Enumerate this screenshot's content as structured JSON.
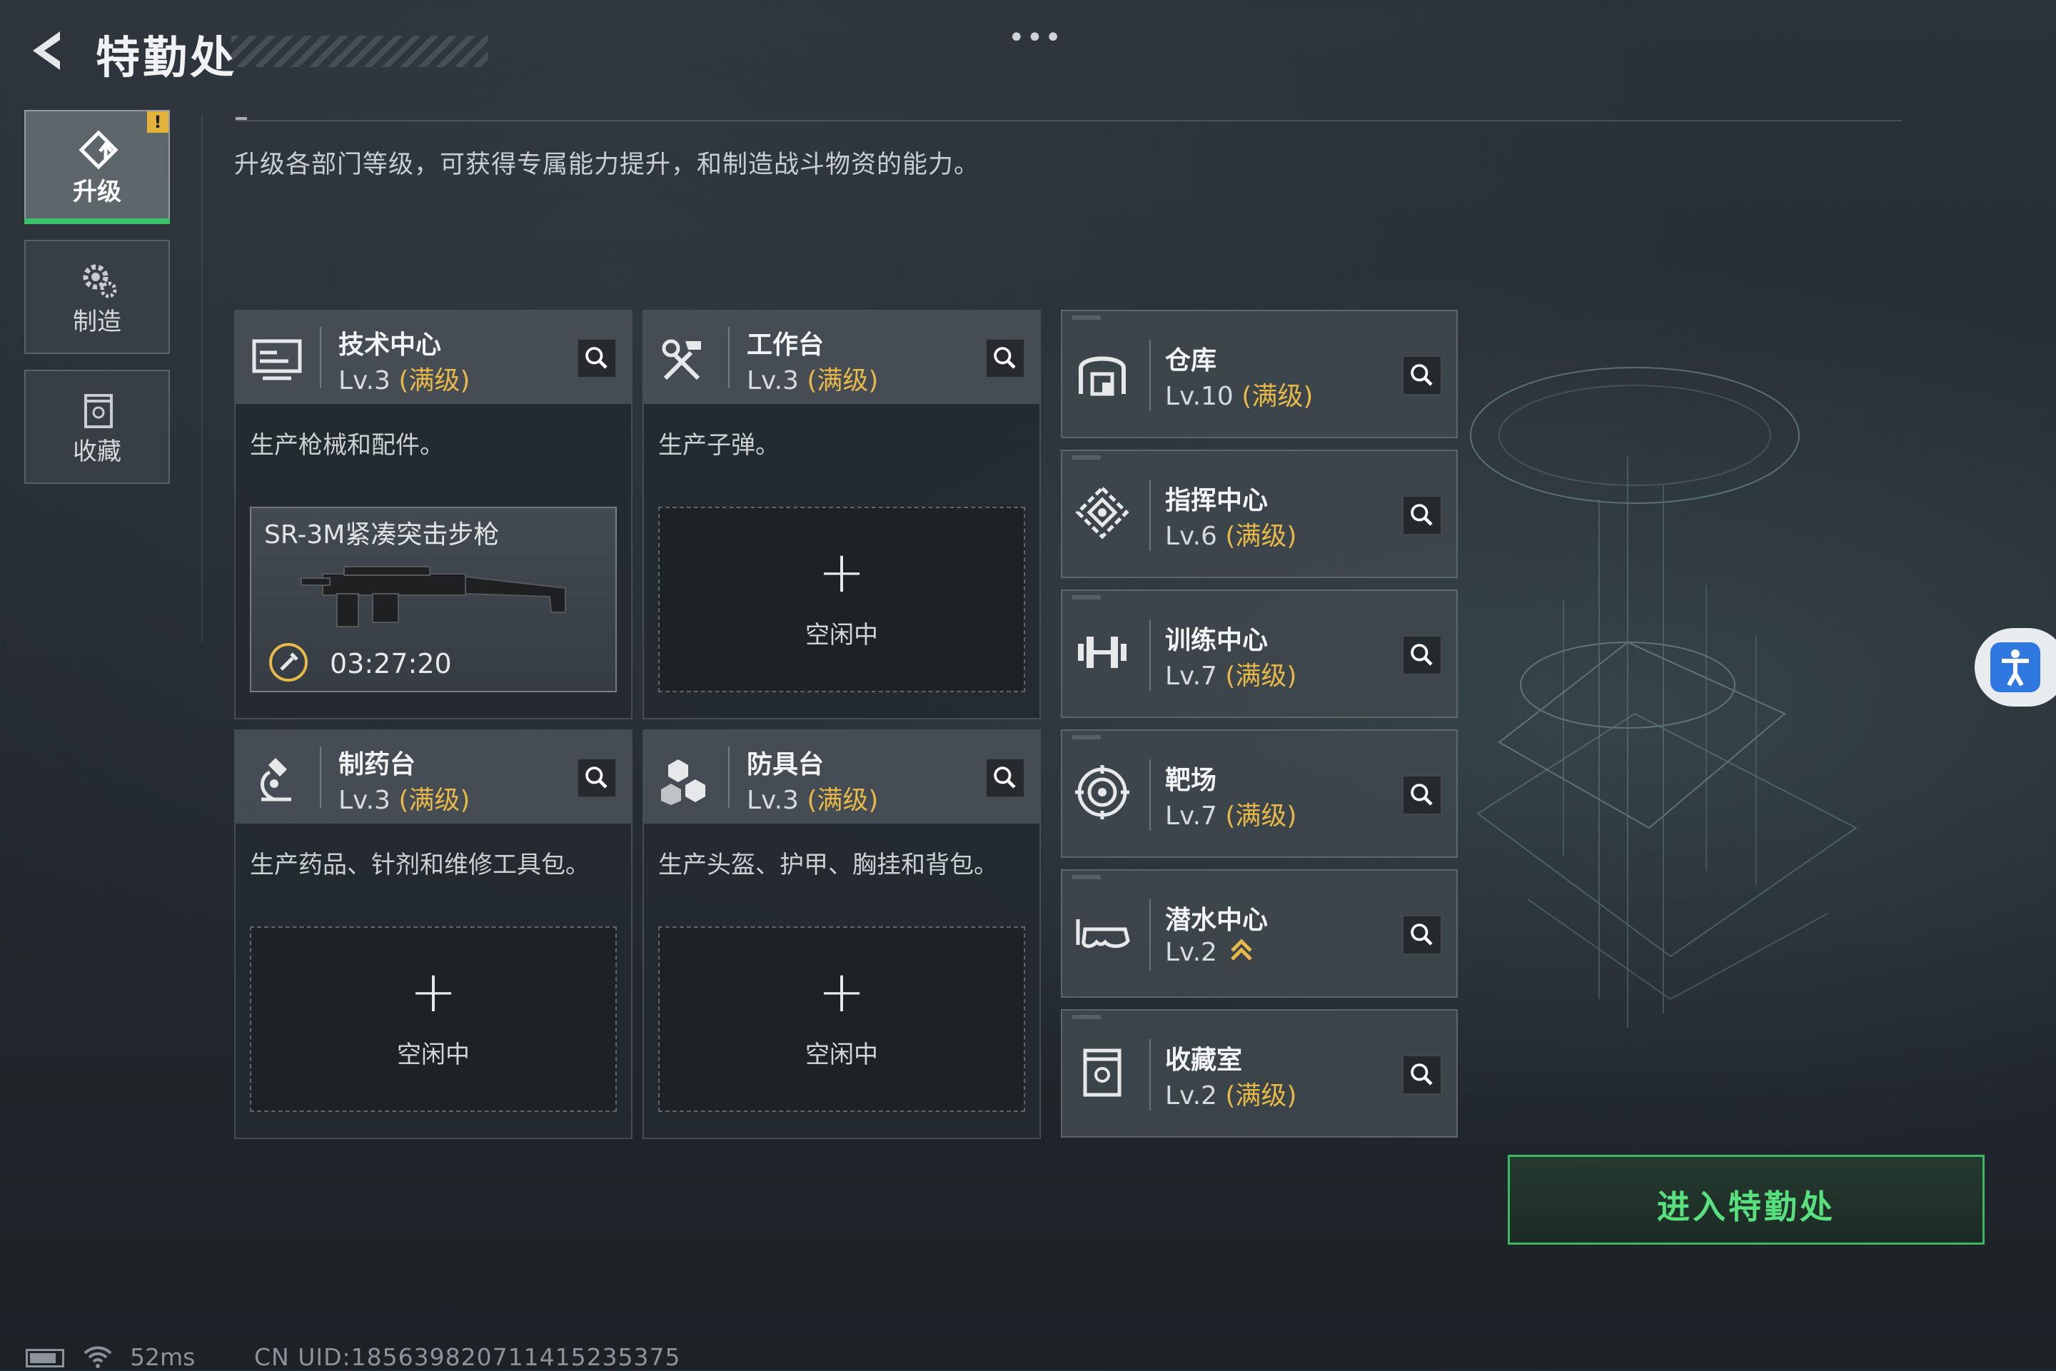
{
  "header": {
    "title": "特勤处",
    "more_label": "•••"
  },
  "sidebar": {
    "items": [
      {
        "label": "升级",
        "icon": "upgrade-icon",
        "active": true,
        "badge": "!"
      },
      {
        "label": "制造",
        "icon": "gear-icon",
        "active": false
      },
      {
        "label": "收藏",
        "icon": "collection-icon",
        "active": false
      }
    ]
  },
  "description": "升级各部门等级，可获得专属能力提升，和制造战斗物资的能力。",
  "workshops": [
    {
      "name": "技术中心",
      "level": "Lv.3",
      "max_label": "(满级)",
      "icon": "monitor-icon",
      "desc": "生产枪械和配件。",
      "slot": {
        "state": "producing",
        "item": "SR-3M紧凑突击步枪",
        "timer": "03:27:20"
      }
    },
    {
      "name": "工作台",
      "level": "Lv.3",
      "max_label": "(满级)",
      "icon": "tools-icon",
      "desc": "生产子弹。",
      "slot": {
        "state": "idle",
        "plus": "+",
        "idle_label": "空闲中"
      }
    },
    {
      "name": "制药台",
      "level": "Lv.3",
      "max_label": "(满级)",
      "icon": "microscope-icon",
      "desc": "生产药品、针剂和维修工具包。",
      "slot": {
        "state": "idle",
        "plus": "+",
        "idle_label": "空闲中"
      }
    },
    {
      "name": "防具台",
      "level": "Lv.3",
      "max_label": "(满级)",
      "icon": "armor-icon",
      "desc": "生产头盔、护甲、胸挂和背包。",
      "slot": {
        "state": "idle",
        "plus": "+",
        "idle_label": "空闲中"
      }
    }
  ],
  "buildings": [
    {
      "name": "仓库",
      "level": "Lv.10",
      "max_label": "(满级)",
      "icon": "warehouse-icon"
    },
    {
      "name": "指挥中心",
      "level": "Lv.6",
      "max_label": "(满级)",
      "icon": "command-icon"
    },
    {
      "name": "训练中心",
      "level": "Lv.7",
      "max_label": "(满级)",
      "icon": "dumbbell-icon"
    },
    {
      "name": "靶场",
      "level": "Lv.7",
      "max_label": "(满级)",
      "icon": "target-icon"
    },
    {
      "name": "潜水中心",
      "level": "Lv.2",
      "max_label": "",
      "upgradable": true,
      "icon": "diving-mask-icon"
    },
    {
      "name": "收藏室",
      "level": "Lv.2",
      "max_label": "(满级)",
      "icon": "collection-room-icon"
    }
  ],
  "enter_button": "进入特勤处",
  "status": {
    "ping": "52ms",
    "uid": "CN UID:185639820711415235375"
  },
  "colors": {
    "accent_green": "#3fb862",
    "max_level_gold": "#e8b948",
    "badge_yellow": "#e2b23a",
    "access_blue": "#2f78e0"
  }
}
